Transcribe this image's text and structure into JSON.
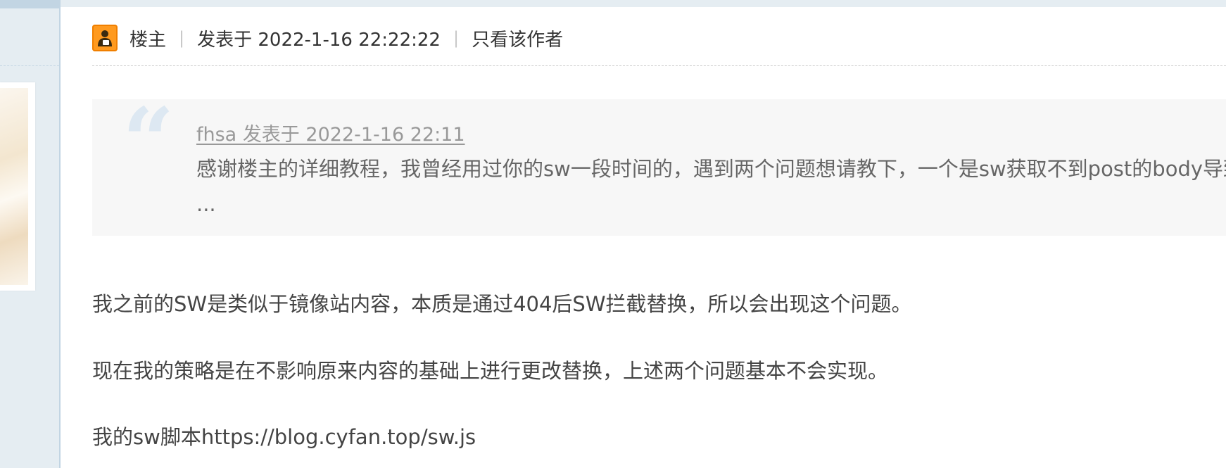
{
  "post": {
    "author_role": "楼主",
    "separator": "|",
    "posted_time": "发表于 2022-1-16 22:22:22",
    "view_author_only": "只看该作者"
  },
  "quote": {
    "author_line": "fhsa 发表于 2022-1-16 22:11",
    "text": "感谢楼主的详细教程，我曾经用过你的sw一段时间的，遇到两个问题想请教下，一个是sw获取不到post的body导致 ..."
  },
  "body": {
    "lines": [
      "我之前的SW是类似于镜像站内容，本质是通过404后SW拦截替换，所以会出现这个问题。",
      "现在我的策略是在不影响原来内容的基础上进行更改替换，上述两个问题基本不会实现。",
      "我的sw脚本https://blog.cyfan.top/sw.js"
    ]
  },
  "colors": {
    "author_icon": "#ff9a1f",
    "quote_bg": "#f7f7f7",
    "quote_mark": "#dde8f2",
    "frame_blue": "#e5edf2"
  },
  "icons": {
    "author_badge": "user-badge-icon",
    "quote_mark": "quote-mark-icon"
  }
}
